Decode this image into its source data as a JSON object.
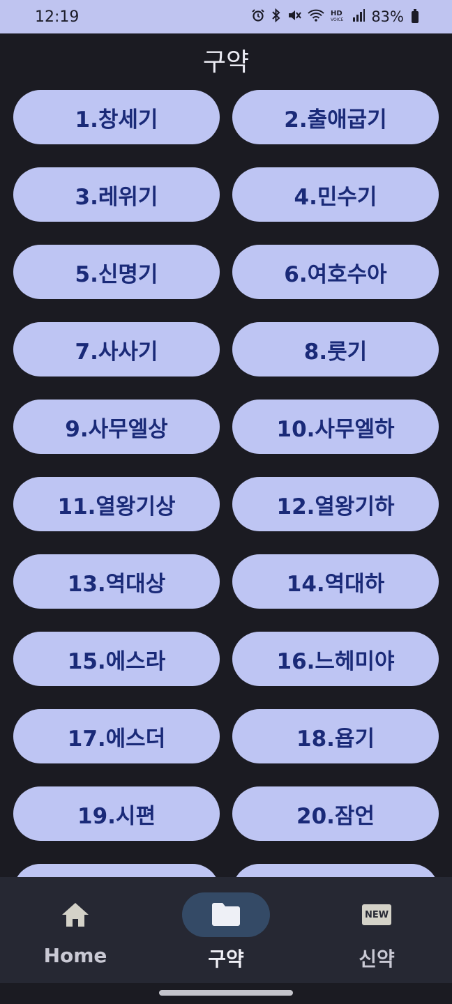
{
  "status_bar": {
    "time": "12:19",
    "battery": "83%",
    "icons": [
      "alarm-icon",
      "bluetooth-icon",
      "mute-icon",
      "wifi-icon",
      "hd-voice-icon",
      "signal-icon",
      "battery-icon"
    ]
  },
  "header": {
    "title": "구약"
  },
  "books": [
    "1.창세기",
    "2.출애굽기",
    "3.레위기",
    "4.민수기",
    "5.신명기",
    "6.여호수아",
    "7.사사기",
    "8.룻기",
    "9.사무엘상",
    "10.사무엘하",
    "11.열왕기상",
    "12.열왕기하",
    "13.역대상",
    "14.역대하",
    "15.에스라",
    "16.느헤미야",
    "17.에스더",
    "18.욥기",
    "19.시편",
    "20.잠언",
    "",
    ""
  ],
  "bottom_nav": {
    "items": [
      {
        "label": "Home",
        "icon": "home-icon",
        "active": false
      },
      {
        "label": "구약",
        "icon": "folder-icon",
        "active": true
      },
      {
        "label": "신약",
        "icon": "new-badge-icon",
        "active": false
      }
    ],
    "new_badge_text": "NEW"
  },
  "colors": {
    "background": "#1b1b22",
    "button": "#bec5f3",
    "button_text": "#1a2a78",
    "status_bar": "#bfc4f0",
    "nav_bar": "#262833",
    "active_indicator": "#344a66"
  }
}
